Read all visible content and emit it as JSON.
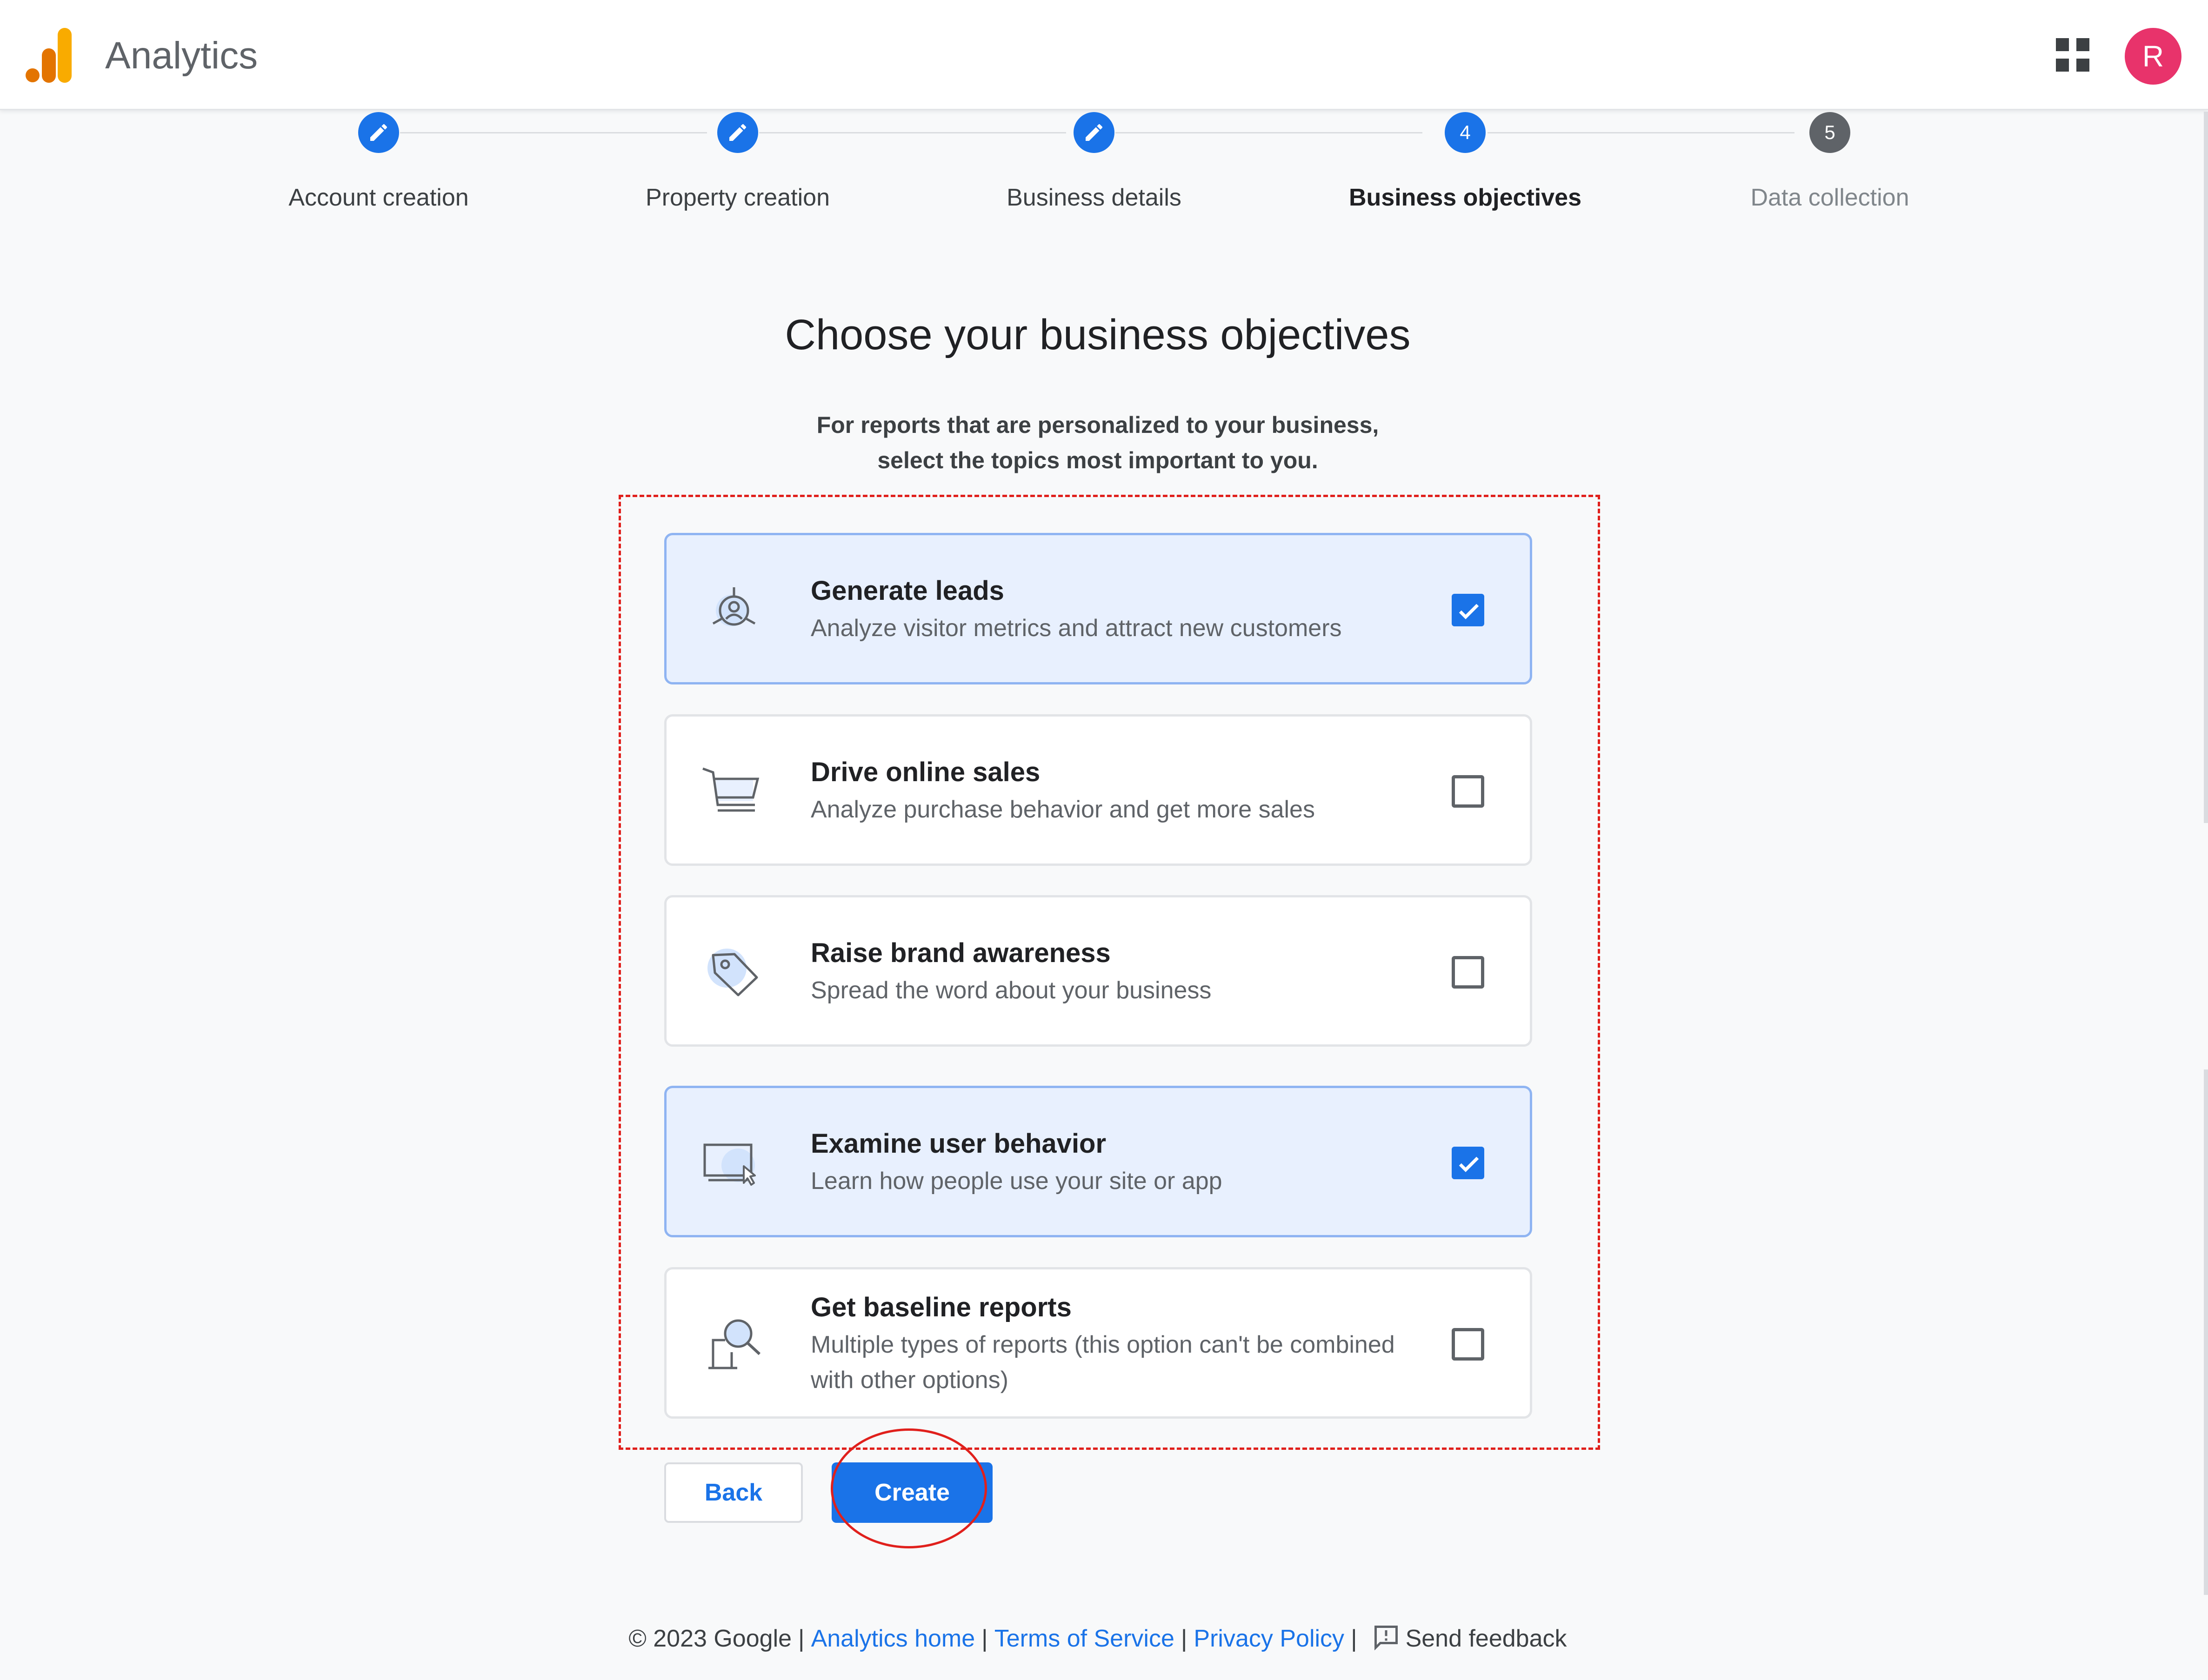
{
  "header": {
    "brand": "Analytics",
    "avatar_initial": "R",
    "icons": [
      "analytics-logo",
      "apps-grid-icon",
      "account-avatar"
    ]
  },
  "stepper": {
    "steps": [
      {
        "label": "Account creation",
        "state": "done"
      },
      {
        "label": "Property creation",
        "state": "done"
      },
      {
        "label": "Business details",
        "state": "done"
      },
      {
        "label": "Business objectives",
        "state": "current",
        "number": "4"
      },
      {
        "label": "Data collection",
        "state": "upcoming",
        "number": "5"
      }
    ]
  },
  "main": {
    "title": "Choose your business objectives",
    "subtitle_line1": "For reports that are personalized to your business,",
    "subtitle_line2": "select the topics most important to you."
  },
  "options": [
    {
      "title": "Generate leads",
      "desc": "Analyze visitor metrics and attract new customers",
      "checked": true,
      "icon": "leads-target-icon"
    },
    {
      "title": "Drive online sales",
      "desc": "Analyze purchase behavior and get more sales",
      "checked": false,
      "icon": "shopping-cart-icon"
    },
    {
      "title": "Raise brand awareness",
      "desc": "Spread the word about your business",
      "checked": false,
      "icon": "price-tag-icon"
    },
    {
      "title": "Examine user behavior",
      "desc": "Learn how people use your site or app",
      "checked": true,
      "icon": "screen-cursor-icon"
    },
    {
      "title": "Get baseline reports",
      "desc_line1": "Multiple types of reports (this option can't be combined",
      "desc_line2": "with other options)",
      "checked": false,
      "icon": "magnifier-report-icon"
    }
  ],
  "actions": {
    "back_label": "Back",
    "create_label": "Create"
  },
  "footer": {
    "copyright": "© 2023 Google",
    "sep": "|",
    "analytics_home": "Analytics home",
    "terms": "Terms of Service",
    "privacy": "Privacy Policy",
    "feedback": "Send feedback"
  },
  "colors": {
    "accent": "#1a73e8",
    "selected_card_bg": "#e8f0fe",
    "annotation_red": "#e0201c",
    "avatar": "#e8336b"
  }
}
